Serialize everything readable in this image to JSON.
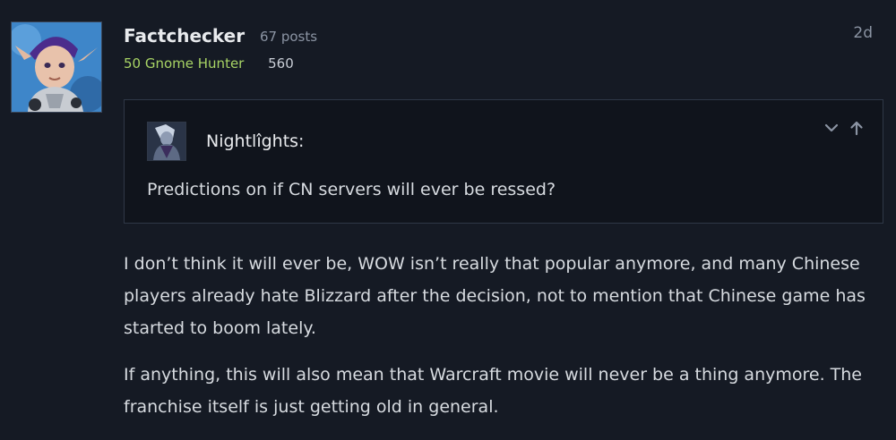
{
  "post": {
    "author": {
      "name": "Factchecker",
      "post_count": "67 posts",
      "character_class": "50 Gnome Hunter",
      "score": "560",
      "avatar_icon": "gnome-hunter-avatar-icon"
    },
    "age": "2d",
    "quote": {
      "user": "Nightlîghts:",
      "text": "Predictions on if CN servers will ever be ressed?",
      "avatar_icon": "nightlights-avatar-icon",
      "controls": {
        "expand_icon": "chevron-down-icon",
        "jump_icon": "arrow-up-icon"
      }
    },
    "body": {
      "paragraphs": [
        "I don’t think it will ever be, WOW isn’t really that popular anymore, and many Chinese players already hate Blizzard after the decision, not to mention that Chinese game has started to boom lately.",
        "If anything, this will also mean that Warcraft movie will never be a thing anymore. The franchise itself is just getting old in general."
      ]
    }
  },
  "colors": {
    "background": "#151a24",
    "class_color": "#a8d465",
    "muted": "#8b94a3",
    "text": "#d7dbe0"
  }
}
